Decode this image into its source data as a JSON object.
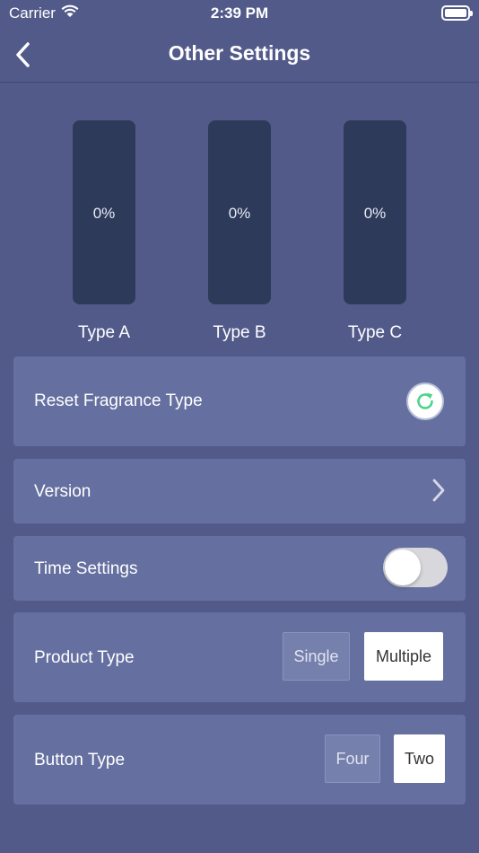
{
  "status_bar": {
    "carrier": "Carrier",
    "time": "2:39 PM"
  },
  "nav": {
    "title": "Other Settings"
  },
  "gauges": [
    {
      "value": "0%",
      "level": 0,
      "label": "Type A"
    },
    {
      "value": "0%",
      "level": 0,
      "label": "Type B"
    },
    {
      "value": "0%",
      "level": 0,
      "label": "Type C"
    }
  ],
  "settings": {
    "reset_label": "Reset Fragrance Type",
    "version_label": "Version",
    "time_label": "Time Settings",
    "time_enabled": false,
    "product_type": {
      "label": "Product Type",
      "options": [
        "Single",
        "Multiple"
      ],
      "selected": "Multiple"
    },
    "button_type": {
      "label": "Button Type",
      "options": [
        "Four",
        "Two"
      ],
      "selected": "Two"
    }
  },
  "colors": {
    "background": "#525a8a",
    "card": "#6570a0",
    "gauge": "#2d3a59",
    "accent": "#4cd48a"
  }
}
